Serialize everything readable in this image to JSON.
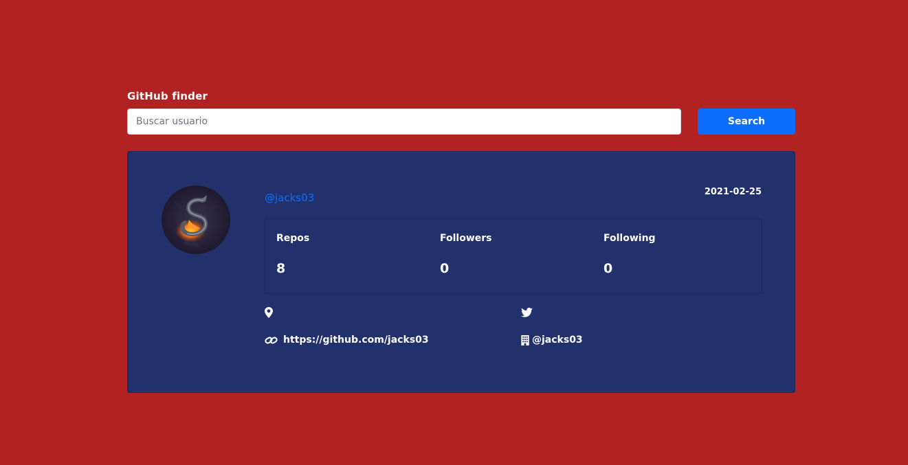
{
  "header": {
    "title": "GitHub finder"
  },
  "search": {
    "placeholder": "Buscar usuario",
    "value": "",
    "button_label": "Search"
  },
  "profile": {
    "username": "@jacks03",
    "created_at": "2021-02-25",
    "stats": [
      {
        "label": "Repos",
        "value": "8"
      },
      {
        "label": "Followers",
        "value": "0"
      },
      {
        "label": "Following",
        "value": "0"
      }
    ],
    "location": "",
    "twitter": "",
    "blog": "https://github.com/jacks03",
    "company": "@jacks03",
    "icons": {
      "location": "map-marker-icon",
      "twitter": "twitter-icon",
      "blog": "link-icon",
      "company": "building-icon"
    }
  },
  "colors": {
    "background": "#b22222",
    "card": "#22316c",
    "accent": "#0d6efd",
    "text": "#ffffff"
  }
}
